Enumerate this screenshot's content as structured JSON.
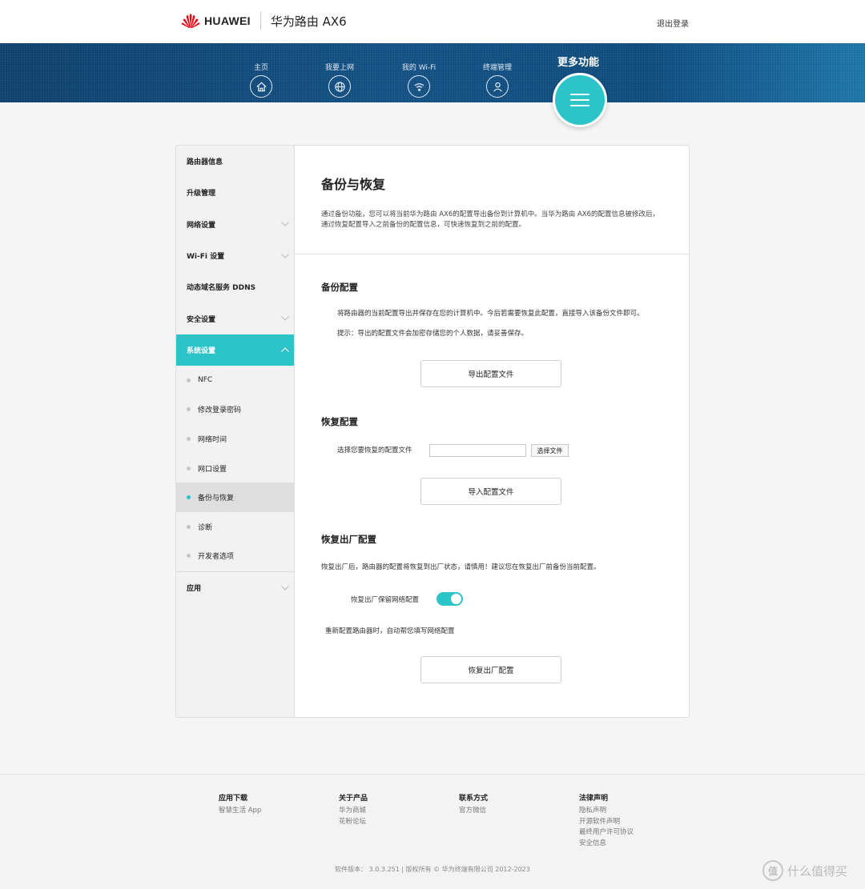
{
  "header": {
    "brand": "HUAWEI",
    "product": "华为路由 AX6",
    "logout": "退出登录"
  },
  "nav": {
    "items": [
      {
        "label": "主页",
        "icon": "home-icon"
      },
      {
        "label": "我要上网",
        "icon": "globe-icon"
      },
      {
        "label": "我的 Wi-Fi",
        "icon": "wifi-icon"
      },
      {
        "label": "终端管理",
        "icon": "user-icon"
      }
    ],
    "more": {
      "label": "更多功能",
      "icon": "menu-icon"
    }
  },
  "sidebar": {
    "items": [
      {
        "label": "路由器信息"
      },
      {
        "label": "升级管理"
      },
      {
        "label": "网络设置"
      },
      {
        "label": "Wi-Fi 设置"
      },
      {
        "label": "动态域名服务 DDNS"
      },
      {
        "label": "安全设置"
      },
      {
        "label": "系统设置"
      }
    ],
    "sub": [
      {
        "label": "NFC"
      },
      {
        "label": "修改登录密码"
      },
      {
        "label": "网络时间"
      },
      {
        "label": "网口设置"
      },
      {
        "label": "备份与恢复"
      },
      {
        "label": "诊断"
      },
      {
        "label": "开发者选项"
      }
    ],
    "apps": {
      "label": "应用"
    }
  },
  "content": {
    "title": "备份与恢复",
    "intro": "通过备份功能，您可以将当前华为路由 AX6的配置导出备份到计算机中。当华为路由 AX6的配置信息被修改后，通过恢复配置导入之前备份的配置信息，可快速恢复到之前的配置。",
    "backup": {
      "title": "备份配置",
      "desc": "将路由器的当前配置导出并保存在您的计算机中。今后若需要恢复此配置，直接导入该备份文件即可。",
      "tip": "提示：导出的配置文件会加密存储您的个人数据，请妥善保存。",
      "button": "导出配置文件"
    },
    "restore": {
      "title": "恢复配置",
      "file_label": "选择您要恢复的配置文件",
      "file_value": "",
      "choose_button": "选择文件",
      "button": "导入配置文件"
    },
    "factory": {
      "title": "恢复出厂配置",
      "desc": "恢复出厂后，路由器的配置将恢复到出厂状态，请慎用！建议您在恢复出厂前备份当前配置。",
      "keep_label": "恢复出厂保留网络配置",
      "keep_enabled": true,
      "keep_desc": "重新配置路由器时，自动帮您填写网络配置",
      "button": "恢复出厂配置"
    }
  },
  "footer": {
    "columns": [
      {
        "head": "应用下载",
        "links": [
          "智慧生活 App"
        ]
      },
      {
        "head": "关于产品",
        "links": [
          "华为商城",
          "花粉论坛"
        ]
      },
      {
        "head": "联系方式",
        "links": [
          "官方微信"
        ]
      },
      {
        "head": "法律声明",
        "links": [
          "隐私声明",
          "开源软件声明",
          "最终用户许可协议",
          "安全信息"
        ]
      }
    ],
    "copyright": "软件版本： 3.0.3.251 | 版权所有 © 华为终端有限公司 2012-2023"
  },
  "watermark": {
    "icon_text": "值",
    "text": "什么值得买"
  },
  "colors": {
    "accent": "#2cc3c9",
    "nav_band": "#124f82"
  }
}
